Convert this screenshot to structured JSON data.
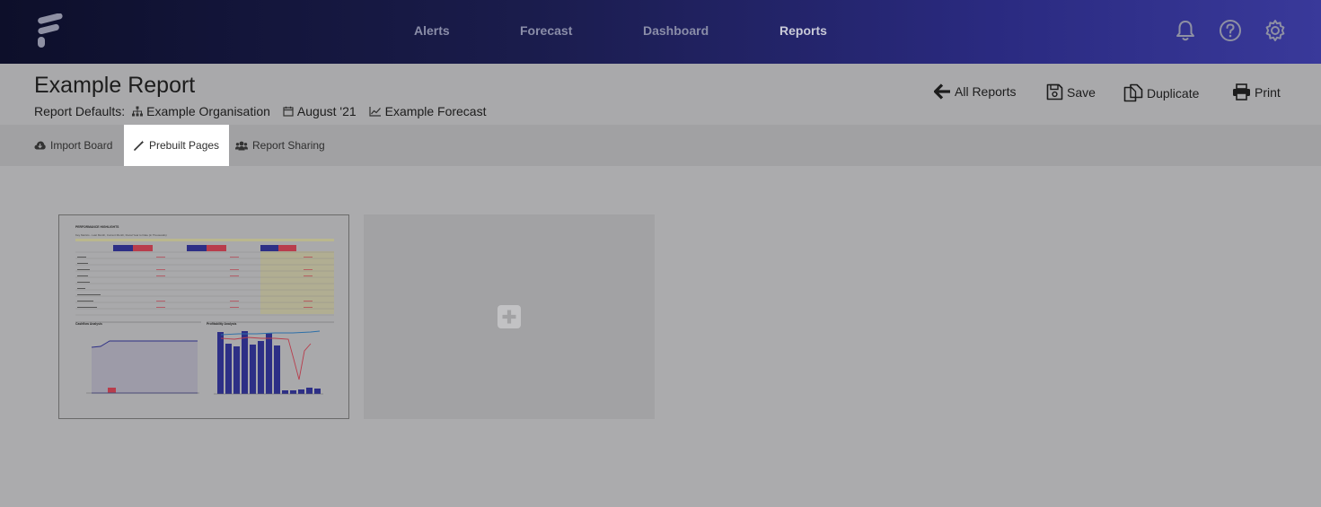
{
  "nav": {
    "items": [
      {
        "label": "Alerts"
      },
      {
        "label": "Forecast"
      },
      {
        "label": "Dashboard"
      },
      {
        "label": "Reports"
      }
    ]
  },
  "header": {
    "title": "Example Report",
    "defaults_label": "Report Defaults:",
    "organisation": "Example Organisation",
    "period": "August '21",
    "forecast": "Example Forecast"
  },
  "actions": {
    "all_reports": "All Reports",
    "save": "Save",
    "duplicate": "Duplicate",
    "print": "Print"
  },
  "tabs": [
    {
      "label": "Import Board"
    },
    {
      "label": "Prebuilt Pages"
    },
    {
      "label": "Report Sharing"
    }
  ],
  "preview": {
    "heading": "PERFORMANCE HIGHLIGHTS",
    "subheading": "Key Metrics - Last Month, Current Month, Fiscal Year to Date (in Thousands)",
    "chart1_title": "Cashflow Analysis",
    "chart2_title": "Profitability Analysis"
  }
}
